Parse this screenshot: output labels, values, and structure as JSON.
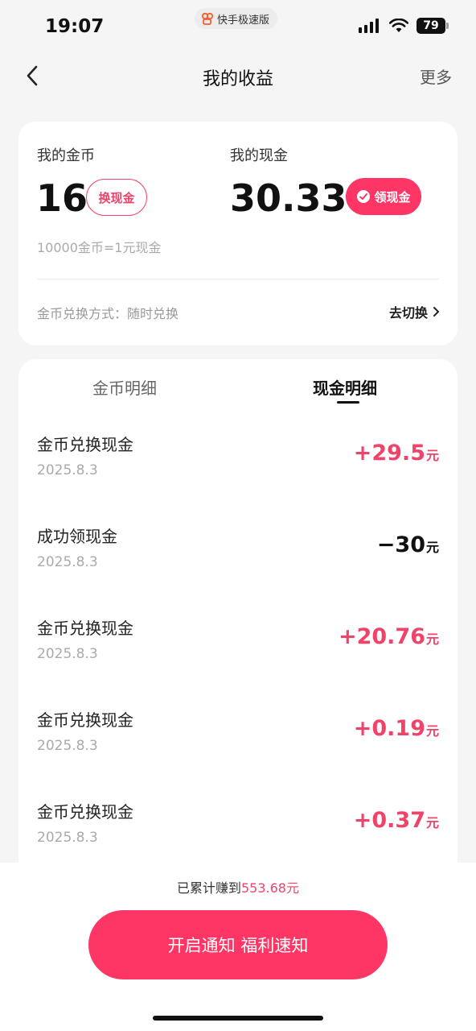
{
  "status_bar": {
    "time": "19:07",
    "app_name": "快手极速版",
    "battery": "79"
  },
  "nav": {
    "title": "我的收益",
    "more": "更多"
  },
  "summary": {
    "coin_label": "我的金币",
    "coin_value": "16",
    "exchange_button": "换现金",
    "cash_label": "我的现金",
    "cash_value": "30.33",
    "claim_button": "领现金",
    "rate": "10000金币=1元现金",
    "method": "金币兑换方式：随时兑换",
    "switch_link": "去切换"
  },
  "tabs": [
    {
      "label": "金币明细",
      "active": false
    },
    {
      "label": "现金明细",
      "active": true
    }
  ],
  "records": [
    {
      "title": "金币兑换现金",
      "date": "2025.8.3",
      "amount": "+29.5",
      "unit": "元",
      "positive": true
    },
    {
      "title": "成功领现金",
      "date": "2025.8.3",
      "amount": "−30",
      "unit": "元",
      "positive": false
    },
    {
      "title": "金币兑换现金",
      "date": "2025.8.3",
      "amount": "+20.76",
      "unit": "元",
      "positive": true
    },
    {
      "title": "金币兑换现金",
      "date": "2025.8.3",
      "amount": "+0.19",
      "unit": "元",
      "positive": true
    },
    {
      "title": "金币兑换现金",
      "date": "2025.8.3",
      "amount": "+0.37",
      "unit": "元",
      "positive": true
    }
  ],
  "footer": {
    "total_prefix": "已累计赚到",
    "total_amount": "553.68元",
    "notify_button": "开启通知 福利速知"
  },
  "colors": {
    "accent": "#fe3666",
    "positive": "#f0436a",
    "background": "#f5f5f5"
  }
}
